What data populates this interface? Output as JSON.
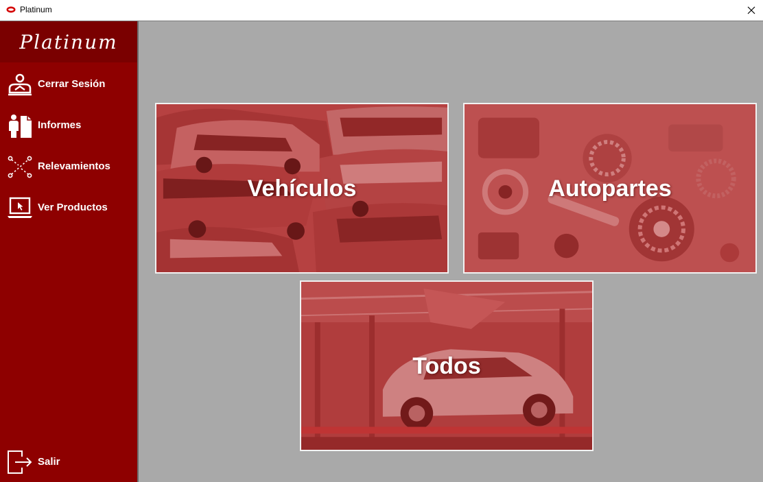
{
  "window": {
    "title": "Platinum",
    "close_icon": "close-icon"
  },
  "sidebar": {
    "brand": "Platinum",
    "items": [
      {
        "label": "Cerrar Sesión",
        "icon": "user-logout-icon"
      },
      {
        "label": "Informes",
        "icon": "report-person-icon"
      },
      {
        "label": "Relevamientos",
        "icon": "survey-dots-icon"
      },
      {
        "label": "Ver Productos",
        "icon": "laptop-cursor-icon"
      }
    ],
    "exit": {
      "label": "Salir",
      "icon": "exit-door-icon"
    }
  },
  "tiles": [
    {
      "label": "Vehículos",
      "scene": "parked-cars"
    },
    {
      "label": "Autopartes",
      "scene": "auto-parts"
    },
    {
      "label": "Todos",
      "scene": "car-assembly-line"
    }
  ],
  "colors": {
    "sidebar": "#8e0000",
    "brand_bar": "#7a0000",
    "main_background": "#a9a9a9",
    "tile_tint": "#c75656",
    "text": "#ffffff"
  }
}
